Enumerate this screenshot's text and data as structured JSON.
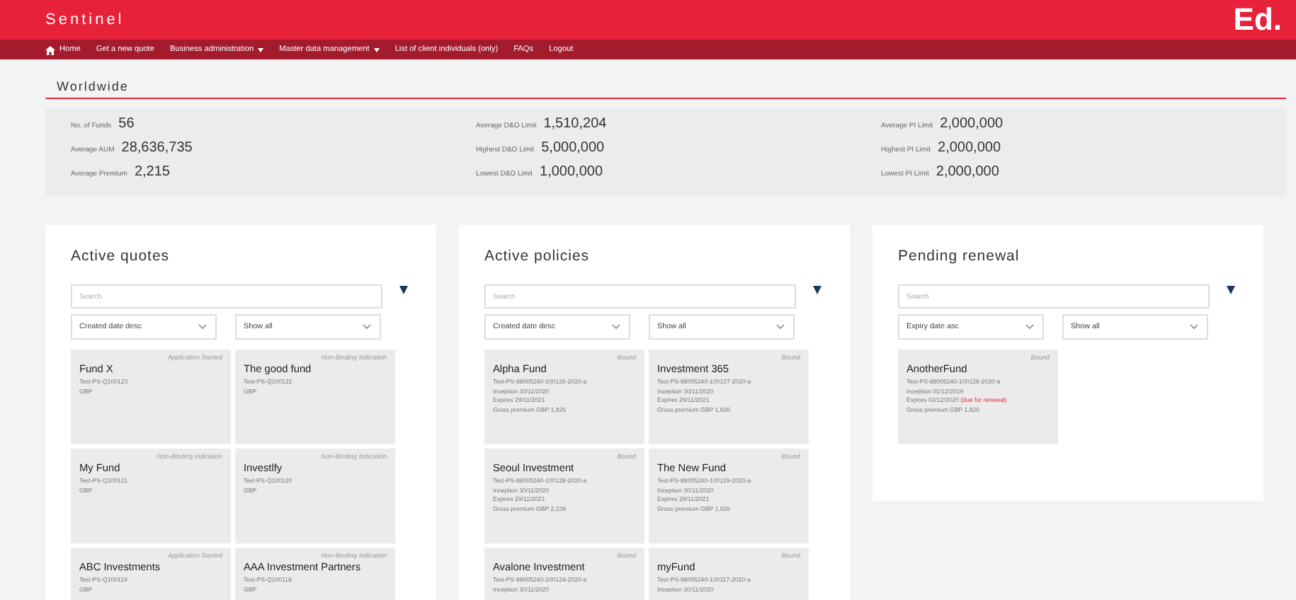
{
  "app": {
    "title": "Sentinel",
    "logo": "Ed."
  },
  "nav": [
    {
      "label": "Home",
      "kind": "home"
    },
    {
      "label": "Get a new quote",
      "kind": "link"
    },
    {
      "label": "Business administration",
      "kind": "menu"
    },
    {
      "label": "Master data management",
      "kind": "menu"
    },
    {
      "label": "List of client individuals (only)",
      "kind": "link"
    },
    {
      "label": "FAQs",
      "kind": "link"
    },
    {
      "label": "Logout",
      "kind": "link"
    }
  ],
  "section_title": "Worldwide",
  "stats": [
    [
      {
        "label": "No. of Funds",
        "value": "56"
      },
      {
        "label": "Average AUM",
        "value": "28,636,735"
      },
      {
        "label": "Average Premium",
        "value": "2,215"
      }
    ],
    [
      {
        "label": "Average D&O Limit",
        "value": "1,510,204"
      },
      {
        "label": "Highest D&O Limit",
        "value": "5,000,000"
      },
      {
        "label": "Lowest D&O Limit",
        "value": "1,000,000"
      }
    ],
    [
      {
        "label": "Average PI Limit",
        "value": "2,000,000"
      },
      {
        "label": "Highest PI Limit",
        "value": "2,000,000"
      },
      {
        "label": "Lowest PI Limit",
        "value": "2,000,000"
      }
    ]
  ],
  "panels": [
    {
      "title": "Active quotes",
      "search": {
        "placeholder": "Search"
      },
      "sort": "Created date desc",
      "filter": "Show all",
      "cards": [
        {
          "status": "Application Started",
          "name": "Fund X",
          "lines": [
            {
              "text": "Test-PS-Q100123"
            },
            {
              "text": "GBP"
            }
          ]
        },
        {
          "status": "Non-Binding Indication",
          "name": "The good fund",
          "lines": [
            {
              "text": "Test-PS-Q100122"
            },
            {
              "text": "GBP"
            }
          ]
        },
        {
          "status": "Non-Binding Indication",
          "name": "My Fund",
          "lines": [
            {
              "text": "Test-PS-Q100121"
            },
            {
              "text": "GBP"
            }
          ]
        },
        {
          "status": "Non-Binding Indication",
          "name": "Investlfy",
          "lines": [
            {
              "text": "Test-PS-Q100120"
            },
            {
              "text": "GBP"
            }
          ]
        },
        {
          "status": "Application Started",
          "name": "ABC Investments",
          "lines": [
            {
              "text": "Test-PS-Q100119"
            },
            {
              "text": "GBP"
            }
          ]
        },
        {
          "status": "Non-Binding Indication",
          "name": "AAA Investment Partners",
          "lines": [
            {
              "text": "Test-PS-Q100118"
            },
            {
              "text": "GBP"
            }
          ]
        }
      ]
    },
    {
      "title": "Active policies",
      "search": {
        "placeholder": "Search"
      },
      "sort": "Created date desc",
      "filter": "Show all",
      "cards": [
        {
          "status": "Bound",
          "name": "Alpha Fund",
          "lines": [
            {
              "text": "Test-PS-88005240-100126-2020-a"
            },
            {
              "text": "Inception 30/11/2020"
            },
            {
              "text": "Expires 29/11/2021"
            },
            {
              "text": "Gross premium GBP 1,826"
            }
          ]
        },
        {
          "status": "Bound",
          "name": "Investment 365",
          "lines": [
            {
              "text": "Test-PS-88005240-100127-2020-a"
            },
            {
              "text": "Inception 30/11/2020"
            },
            {
              "text": "Expires 29/11/2021"
            },
            {
              "text": "Gross premium GBP 1,826"
            }
          ]
        },
        {
          "status": "Bound",
          "name": "Seoul Investment",
          "lines": [
            {
              "text": "Test-PS-88005240-100128-2020-a"
            },
            {
              "text": "Inception 30/11/2020"
            },
            {
              "text": "Expires 29/11/2021"
            },
            {
              "text": "Gross premium GBP 2,339"
            }
          ]
        },
        {
          "status": "Bound",
          "name": "The New Fund",
          "lines": [
            {
              "text": "Test-PS-88005240-100129-2020-a"
            },
            {
              "text": "Inception 30/11/2020"
            },
            {
              "text": "Expires 29/11/2021"
            },
            {
              "text": "Gross premium GBP 1,826"
            }
          ]
        },
        {
          "status": "Bound",
          "name": "Avalone Investment",
          "lines": [
            {
              "text": "Test-PS-88005240-100124-2020-a"
            },
            {
              "text": "Inception 30/11/2020"
            }
          ]
        },
        {
          "status": "Bound",
          "name": "myFund",
          "lines": [
            {
              "text": "Test-PS-88005240-100117-2020-a"
            },
            {
              "text": "Inception 30/11/2020"
            }
          ]
        }
      ]
    },
    {
      "title": "Pending renewal",
      "search": {
        "placeholder": "Search"
      },
      "sort": "Expiry date asc",
      "filter": "Show all",
      "cards": [
        {
          "status": "Bound",
          "name": "AnotherFund",
          "lines": [
            {
              "text": "Test-PS-88005240-100128-2020-a"
            },
            {
              "text": "Inception 01/12/2019"
            },
            {
              "text": "Expires 02/12/2020",
              "note": "(due for renewal)"
            },
            {
              "text": "Gross premium GBP 1,826"
            }
          ]
        }
      ]
    }
  ]
}
